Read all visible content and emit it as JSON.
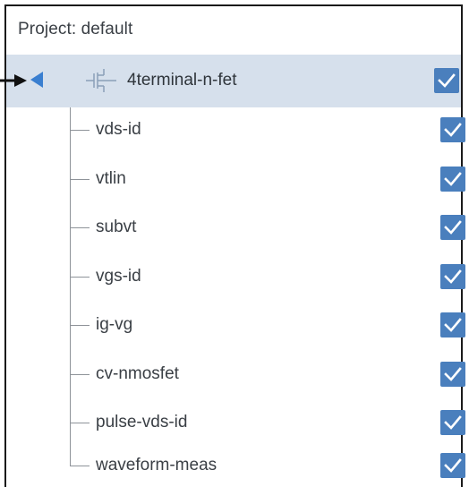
{
  "project": {
    "title": "Project: default"
  },
  "root": {
    "label": "4terminal-n-fet",
    "checked": true,
    "icon": "transistor-icon",
    "highlight_color": "#d6e0ec"
  },
  "items": [
    {
      "label": "vds-id",
      "checked": true
    },
    {
      "label": "vtlin",
      "checked": true
    },
    {
      "label": "subvt",
      "checked": true
    },
    {
      "label": "vgs-id",
      "checked": true
    },
    {
      "label": "ig-vg",
      "checked": true
    },
    {
      "label": "cv-nmosfet",
      "checked": true
    },
    {
      "label": "pulse-vds-id",
      "checked": true
    },
    {
      "label": "waveform-meas",
      "checked": true
    }
  ],
  "colors": {
    "checkbox": "#4a7fbd",
    "toggle": "#3a7fd0",
    "tree_line": "#8e9399"
  }
}
